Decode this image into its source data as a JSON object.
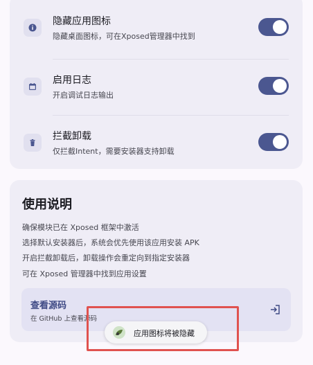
{
  "settings": {
    "rows": [
      {
        "title": "隐藏应用图标",
        "subtitle": "隐藏桌面图标，可在Xposed管理器中找到",
        "icon": "info-icon",
        "enabled": true
      },
      {
        "title": "启用日志",
        "subtitle": "开启调试日志输出",
        "icon": "calendar-icon",
        "enabled": true
      },
      {
        "title": "拦截卸载",
        "subtitle": "仅拦截Intent，需要安装器支持卸载",
        "icon": "trash-icon",
        "enabled": true
      }
    ]
  },
  "help": {
    "title": "使用说明",
    "lines": [
      "确保模块已在 Xposed 框架中激活",
      "选择默认安装器后，系统会优先使用该应用安装 APK",
      "开启拦截卸载后，卸载操作会重定向到指定安装器",
      "可在 Xposed 管理器中找到应用设置"
    ],
    "source": {
      "title": "查看源码",
      "subtitle": "在 GitHub 上查看源码",
      "icon": "open-external-icon"
    }
  },
  "toast": {
    "text": "应用图标将被隐藏",
    "icon": "app-icon"
  },
  "colors": {
    "accent": "#4b5790",
    "card": "#efedf6",
    "highlight": "#e0524f"
  }
}
